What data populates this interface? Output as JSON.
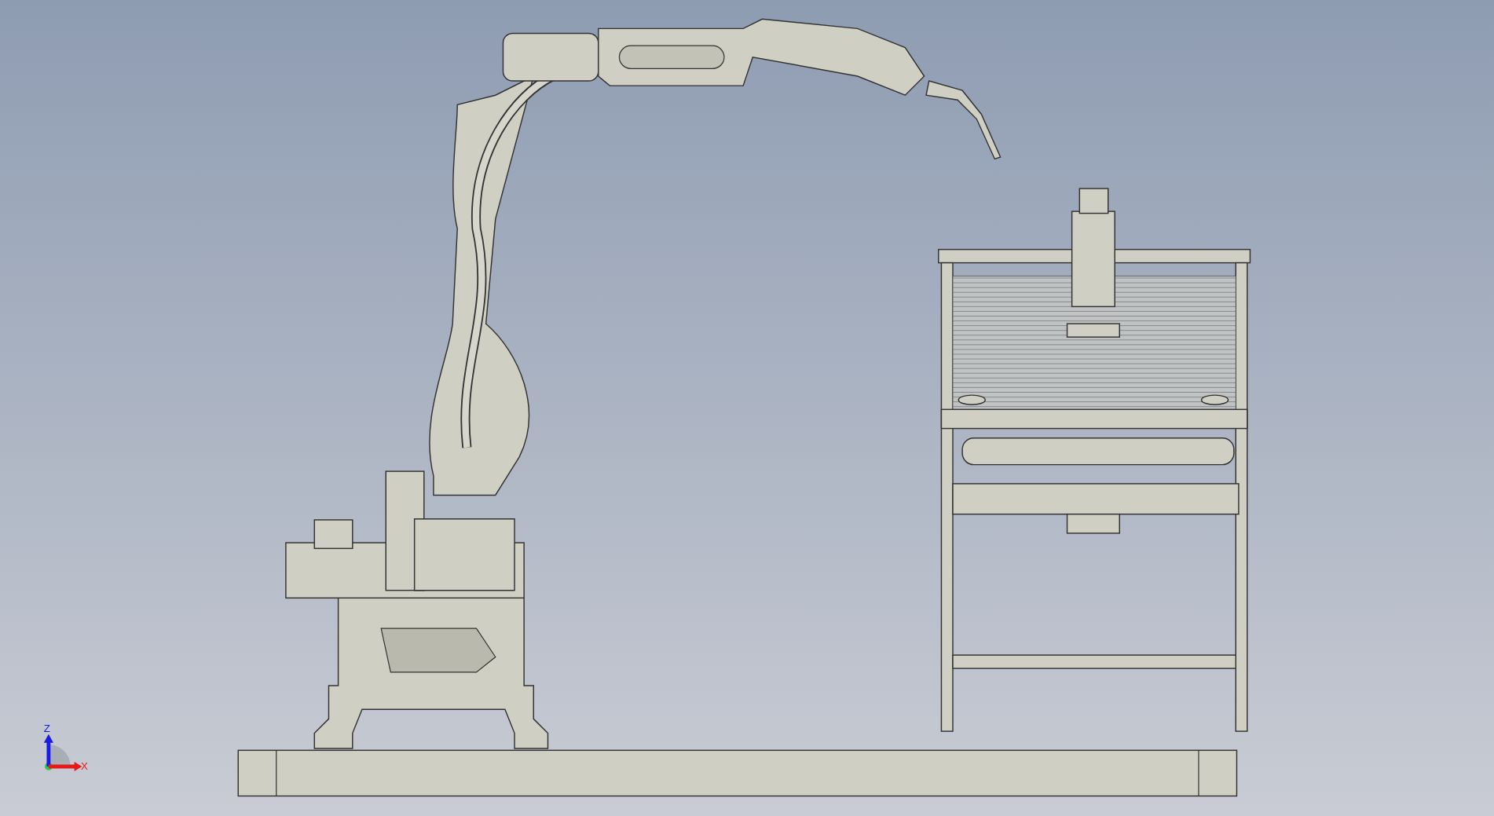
{
  "viewport": {
    "triad": {
      "axes": [
        {
          "label": "Z",
          "color": "#1a1ae6"
        },
        {
          "label": "X",
          "color": "#e61a1a"
        }
      ]
    }
  }
}
